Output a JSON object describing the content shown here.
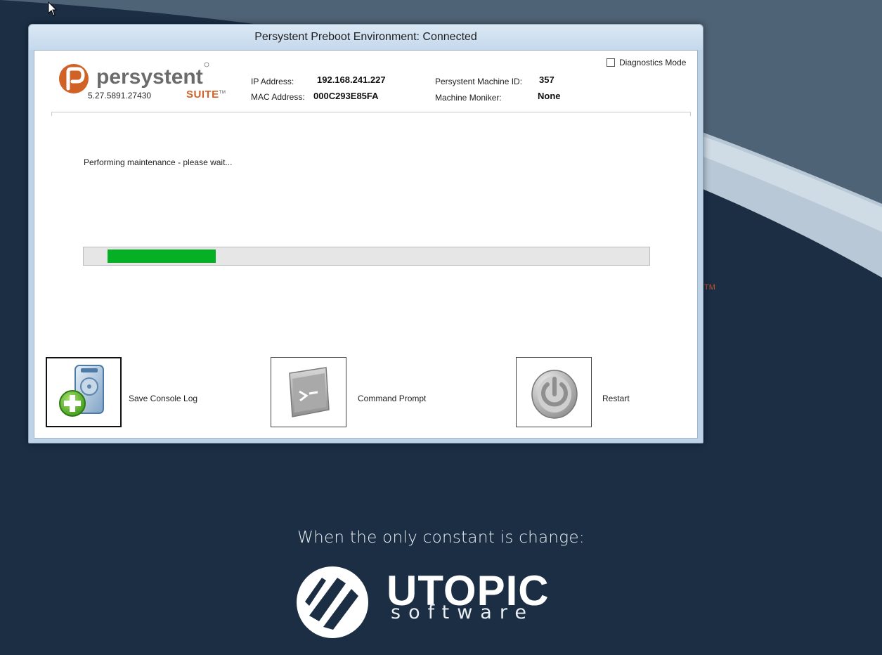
{
  "window": {
    "title": "Persystent Preboot Environment: Connected"
  },
  "brand": {
    "name": "persystent",
    "version": "5.27.5891.27430",
    "suite": "SUITE",
    "trademark": "TM"
  },
  "machine_info": {
    "ip_label": "IP Address:",
    "ip_value": "192.168.241.227",
    "mac_label": "MAC Address:",
    "mac_value": "000C293E85FA",
    "id_label": "Persystent Machine ID:",
    "id_value": "357",
    "moniker_label": "Machine Moniker:",
    "moniker_value": "None"
  },
  "diagnostics": {
    "label": "Diagnostics Mode",
    "checked": false
  },
  "status": {
    "message": "Performing maintenance - please wait..."
  },
  "progress": {
    "start_fraction": 0.042,
    "end_fraction": 0.233,
    "color": "#06b025"
  },
  "actions": [
    {
      "label": "Save Console Log",
      "icon": "save-log-icon"
    },
    {
      "label": "Command Prompt",
      "icon": "command-prompt-icon"
    },
    {
      "label": "Restart",
      "icon": "power-icon"
    }
  ],
  "desktop": {
    "tm_mark": "TM",
    "tagline": "When the only constant is change:",
    "company": "UTOPIC",
    "company_sub": "software"
  },
  "colors": {
    "accent_orange": "#d06226",
    "desktop_navy": "#1b2e44",
    "progress_green": "#06b025"
  }
}
